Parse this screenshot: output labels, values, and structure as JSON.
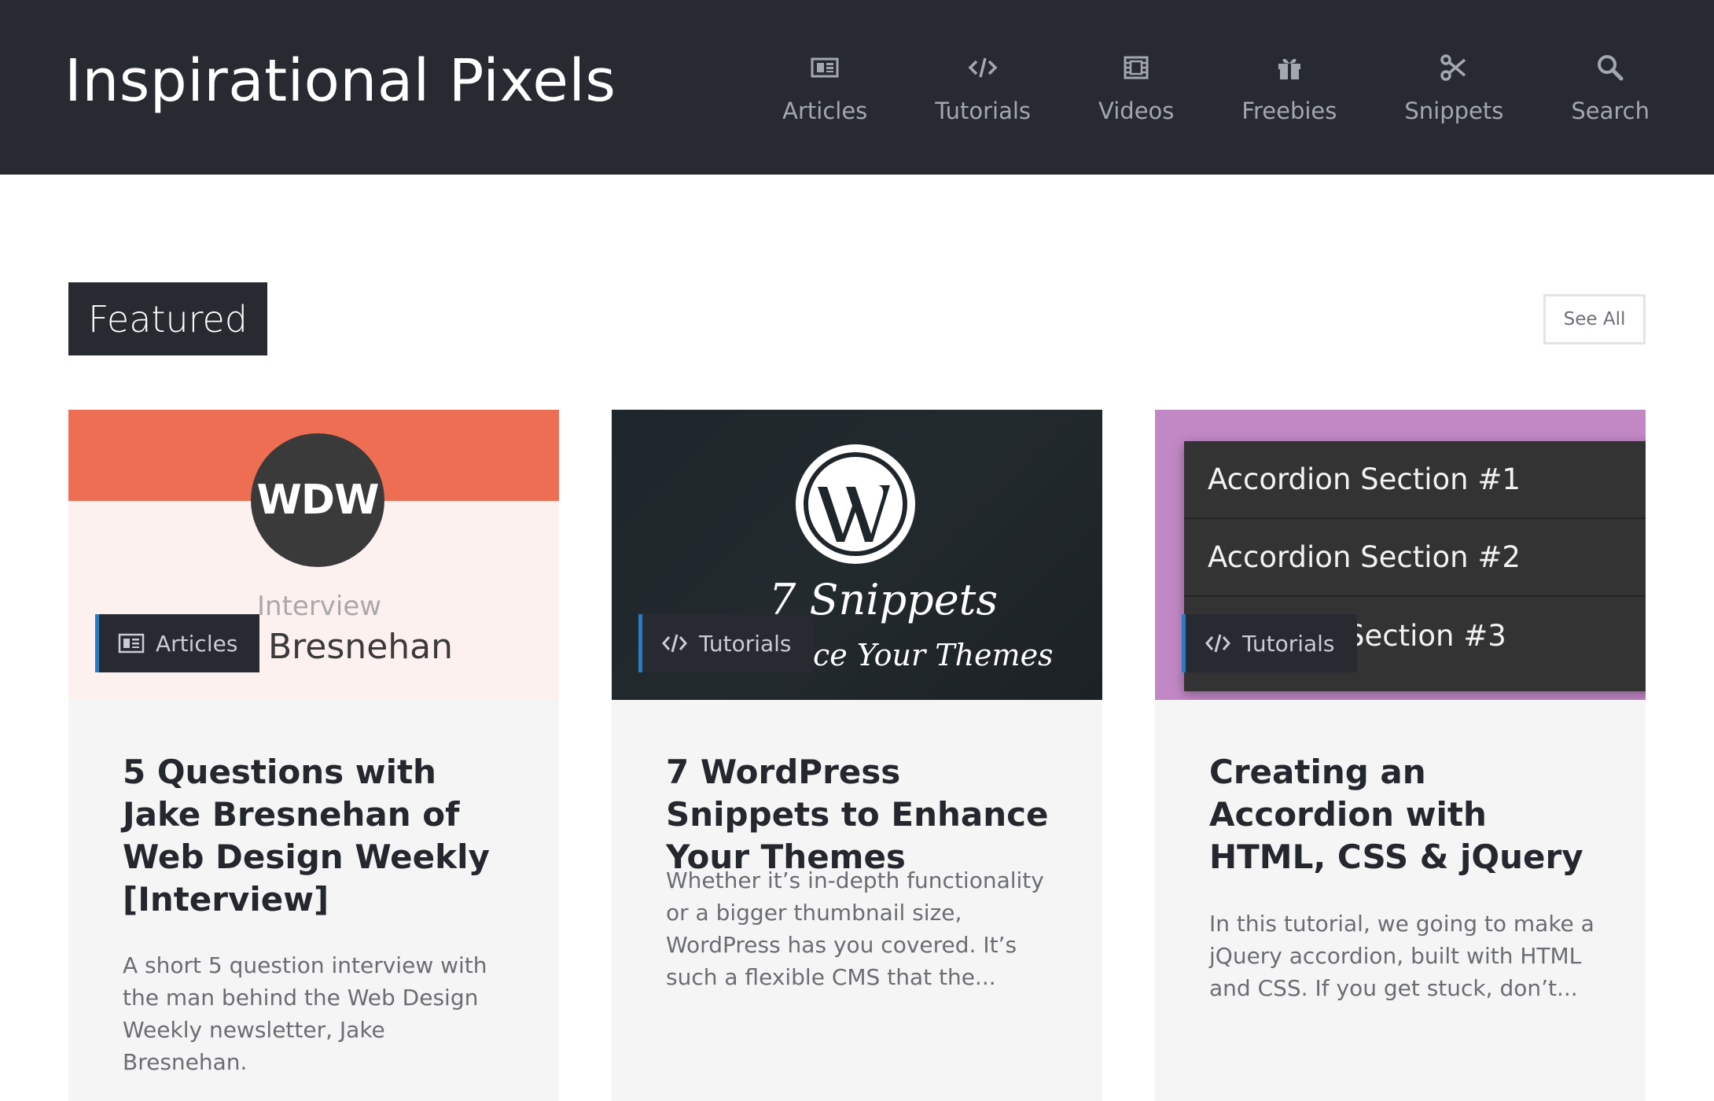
{
  "site": {
    "logo": "Inspirational Pixels"
  },
  "nav": {
    "items": [
      {
        "label": "Articles",
        "icon": "newspaper-icon"
      },
      {
        "label": "Tutorials",
        "icon": "code-icon"
      },
      {
        "label": "Videos",
        "icon": "film-icon"
      },
      {
        "label": "Freebies",
        "icon": "gift-icon"
      },
      {
        "label": "Snippets",
        "icon": "scissors-icon"
      },
      {
        "label": "Search",
        "icon": "search-icon"
      }
    ]
  },
  "section": {
    "title": "Featured",
    "see_all": "See All"
  },
  "cards": [
    {
      "category": "Articles",
      "category_icon": "newspaper-icon",
      "title": "5 Questions with Jake Bresnehan of Web Design Weekly [Interview]",
      "excerpt": "A short 5 question interview with the man behind the Web Design Weekly newsletter, Jake Bresnehan.",
      "thumb": {
        "circle_text": "WDW",
        "line1": "Interview",
        "line2": "Bresnehan",
        "colors": {
          "top": "#ee6e54",
          "bottom": "#fdf1ef"
        }
      }
    },
    {
      "category": "Tutorials",
      "category_icon": "code-icon",
      "title": "7 WordPress Snippets to Enhance Your Themes",
      "excerpt": "Whether it’s in-depth functionality or a bigger thumbnail size, WordPress has you covered. It’s such a flexible CMS that the...",
      "thumb": {
        "line1": "7 Snippets",
        "line2": "ce Your Themes"
      }
    },
    {
      "category": "Tutorials",
      "category_icon": "code-icon",
      "title": "Creating an Accordion with HTML, CSS & jQuery",
      "excerpt": "In this tutorial, we going to make a jQuery accordion, built with HTML and CSS. If you get stuck, don’t...",
      "thumb": {
        "rows": [
          "Accordion Section #1",
          "Accordion Section #2",
          "Section #3"
        ],
        "colors": {
          "bg": "#c288c6",
          "panel": "#333333"
        }
      }
    }
  ],
  "colors": {
    "header_bg": "#272a31",
    "accent_blue": "#2b7bc4",
    "card_bg": "#f5f5f5"
  }
}
